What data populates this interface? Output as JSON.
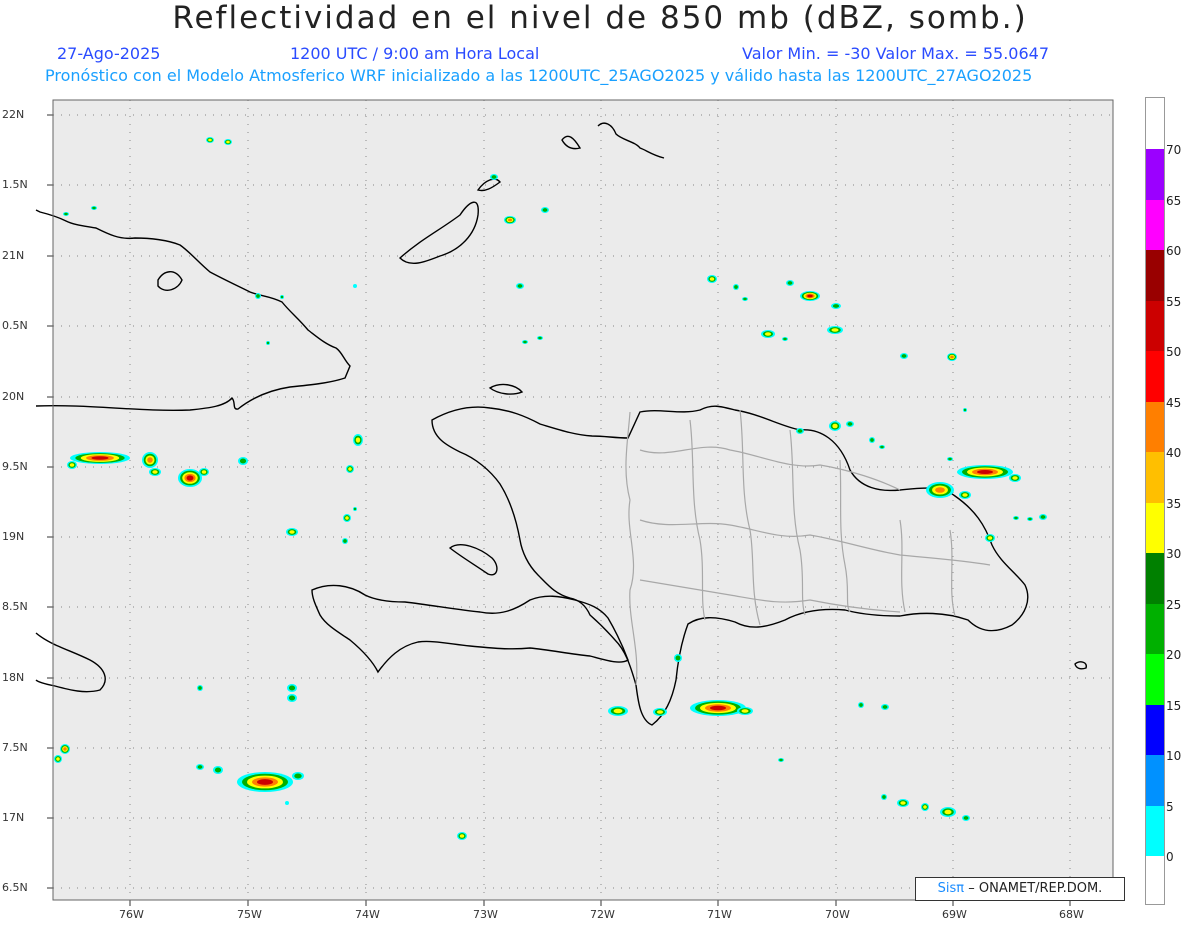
{
  "title": "Reflectividad en el nivel de 850 mb (dBZ, somb.)",
  "date": "27-Ago-2025",
  "time": "1200 UTC / 9:00 am Hora Local",
  "minmax": "Valor Min. = -30  Valor Max. = 55.0647",
  "model_line": "Pronóstico con el Modelo Atmosferico WRF inicializado a las 1200UTC_25AGO2025 y válido hasta las  1200UTC_27AGO2025",
  "lat_labels": [
    "22N",
    "1.5N",
    "21N",
    "0.5N",
    "20N",
    "9.5N",
    "19N",
    "8.5N",
    "18N",
    "7.5N",
    "17N",
    "6.5N"
  ],
  "lon_labels": [
    "76W",
    "75W",
    "74W",
    "73W",
    "72W",
    "71W",
    "70W",
    "69W",
    "68W"
  ],
  "colorbar": {
    "labels": [
      "70",
      "65",
      "60",
      "55",
      "50",
      "45",
      "40",
      "35",
      "30",
      "25",
      "20",
      "15",
      "10",
      "5",
      "0"
    ],
    "colors": [
      "#9b00ff",
      "#ff00ff",
      "#990000",
      "#cc0000",
      "#ff0000",
      "#ff7f00",
      "#ffbf00",
      "#ffff00",
      "#008000",
      "#00b000",
      "#00ff00",
      "#0000ff",
      "#0091ff",
      "#00ffff"
    ]
  },
  "credit_prefix": "Sisπ",
  "credit": "– ONAMET/REP.DOM."
}
